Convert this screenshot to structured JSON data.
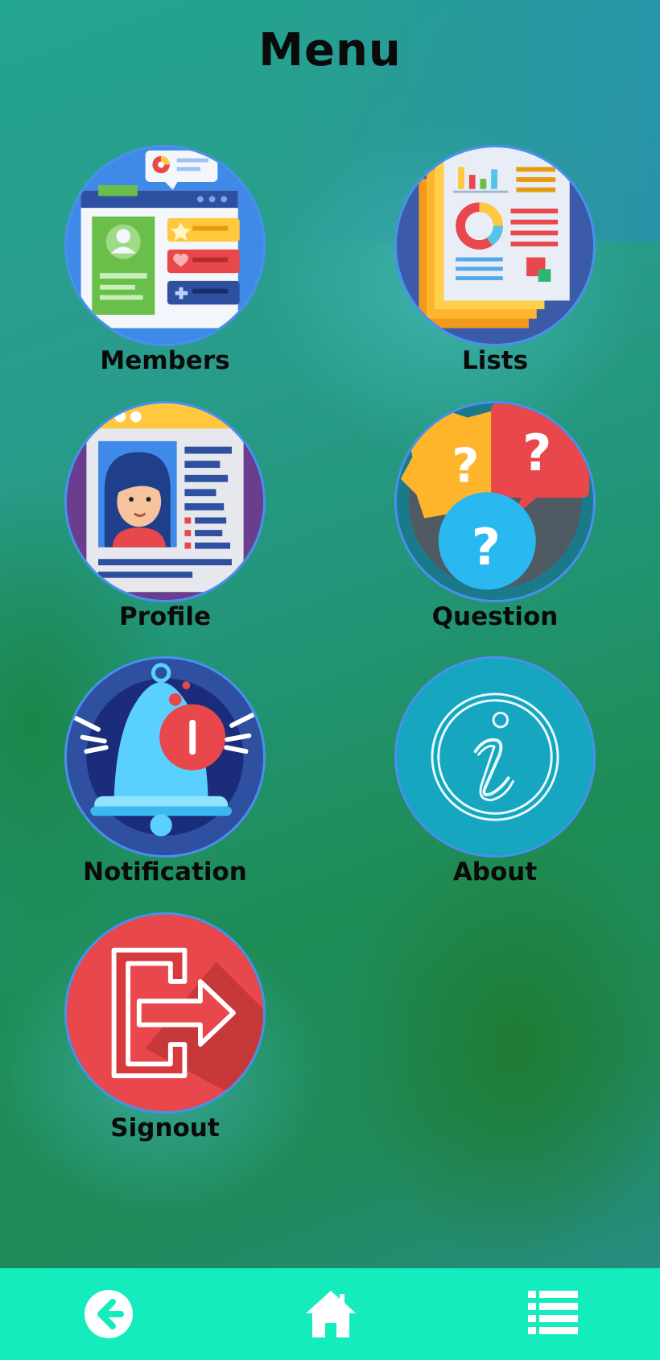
{
  "header": {
    "title": "Menu"
  },
  "menu": {
    "members": "Members",
    "lists": "Lists",
    "profile": "Profile",
    "question": "Question",
    "notification": "Notification",
    "about": "About",
    "signout": "Signout"
  },
  "icons": {
    "members": "members-card-icon",
    "lists": "lists-documents-icon",
    "profile": "profile-card-icon",
    "question": "question-bubbles-icon",
    "notification": "notification-bell-icon",
    "about": "info-icon",
    "signout": "signout-icon",
    "back": "back-arrow-icon",
    "home": "home-icon",
    "list": "list-menu-icon"
  },
  "colors": {
    "nav_bar": "#14ecbd",
    "circle_border": "#4a8ff0",
    "signout_red": "#e8484b",
    "about_teal": "#17a6bf"
  }
}
